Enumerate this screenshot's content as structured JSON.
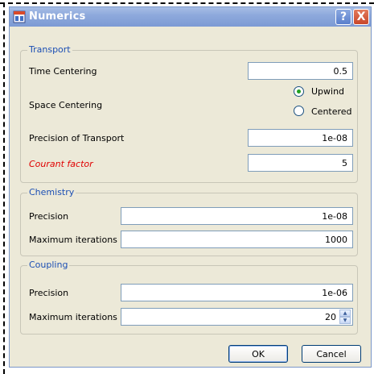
{
  "window": {
    "title": "Numerics",
    "help_glyph": "?",
    "close_glyph": "X",
    "titlebar_color": "#8ea9dc",
    "face_color": "#ece9d8",
    "group_title_color": "#1c4fb4"
  },
  "transport": {
    "title": "Transport",
    "time_centering_label": "Time Centering",
    "time_centering_value": "0.5",
    "space_centering_label": "Space Centering",
    "upwind_label": "Upwind",
    "upwind_selected": true,
    "centered_label": "Centered",
    "centered_selected": false,
    "precision_label": "Precision of Transport",
    "precision_value": "1e-08",
    "courant_label": "Courant factor",
    "courant_value": "5",
    "courant_label_color": "#e00000"
  },
  "chemistry": {
    "title": "Chemistry",
    "precision_label": "Precision",
    "precision_value": "1e-08",
    "max_iter_label": "Maximum iterations",
    "max_iter_value": "1000"
  },
  "coupling": {
    "title": "Coupling",
    "precision_label": "Precision",
    "precision_value": "1e-06",
    "max_iter_label": "Maximum iterations",
    "max_iter_value": "20"
  },
  "buttons": {
    "ok": "OK",
    "cancel": "Cancel"
  },
  "icons": {
    "app": "app-window-icon",
    "spin_up": "chevron-up-icon",
    "spin_down": "chevron-down-icon"
  }
}
